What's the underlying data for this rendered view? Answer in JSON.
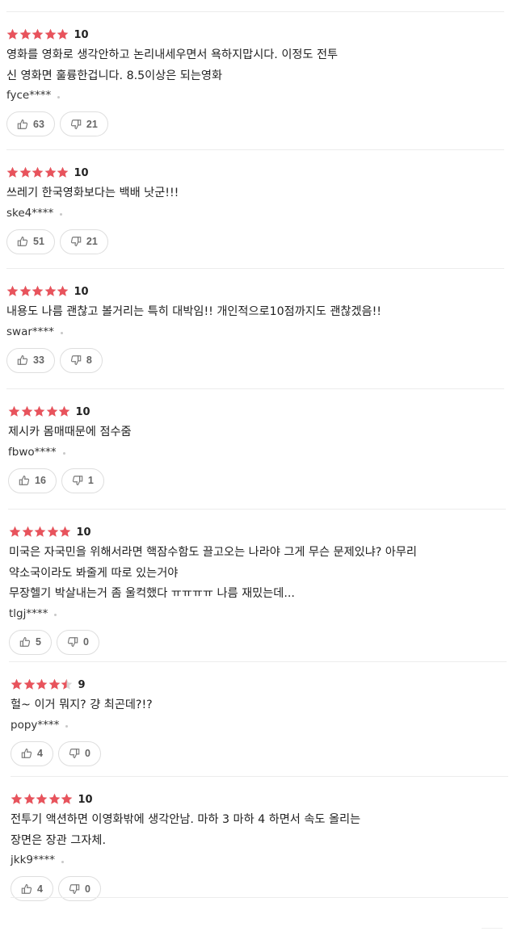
{
  "accent": {
    "star": "#e8535c",
    "star_empty": "#d8d8d8"
  },
  "reviews": [
    {
      "rating": 5,
      "score": "10",
      "text": "영화를 영화로 생각안하고 논리내세우면서 욕하지맙시다. 이정도 전투\n신 영화면 훌륭한겁니다. 8.5이상은 되는영화",
      "user": "fyce****",
      "likes": "63",
      "dislikes": "21"
    },
    {
      "rating": 5,
      "score": "10",
      "text": "쓰레기 한국영화보다는 백배 낫군!!!",
      "user": "ske4****",
      "likes": "51",
      "dislikes": "21"
    },
    {
      "rating": 5,
      "score": "10",
      "text": "내용도 나름 괜찮고 볼거리는 특히 대박임!! 개인적으로10점까지도 괜찮겠음!!",
      "user": "swar****",
      "likes": "33",
      "dislikes": "8"
    },
    {
      "rating": 5,
      "score": "10",
      "text": "제시카 몸매때문에 점수줌",
      "user": "fbwo****",
      "likes": "16",
      "dislikes": "1"
    },
    {
      "rating": 5,
      "score": "10",
      "text": "미국은 자국민을 위해서라면 핵잠수함도 끌고오는 나라야 그게 무슨 문제있냐? 아무리\n약소국이라도 봐줄게 따로 있는거야\n무장헬기 박살내는거 좀 울컥했다 ㅠㅠㅠㅠ 나름 재밌는데...",
      "user": "tlgj****",
      "likes": "5",
      "dislikes": "0"
    },
    {
      "rating": 4.5,
      "score": "9",
      "text": "헐~ 이거 뭐지? 걍 최곤데?!?",
      "user": "popy****",
      "likes": "4",
      "dislikes": "0"
    },
    {
      "rating": 5,
      "score": "10",
      "text": "전투기 액션하면 이영화밖에 생각안남. 마하 3 마하 4 하면서 속도 올리는\n장면은 장관 그자체.",
      "user": "jkk9****",
      "likes": "4",
      "dislikes": "0"
    }
  ]
}
